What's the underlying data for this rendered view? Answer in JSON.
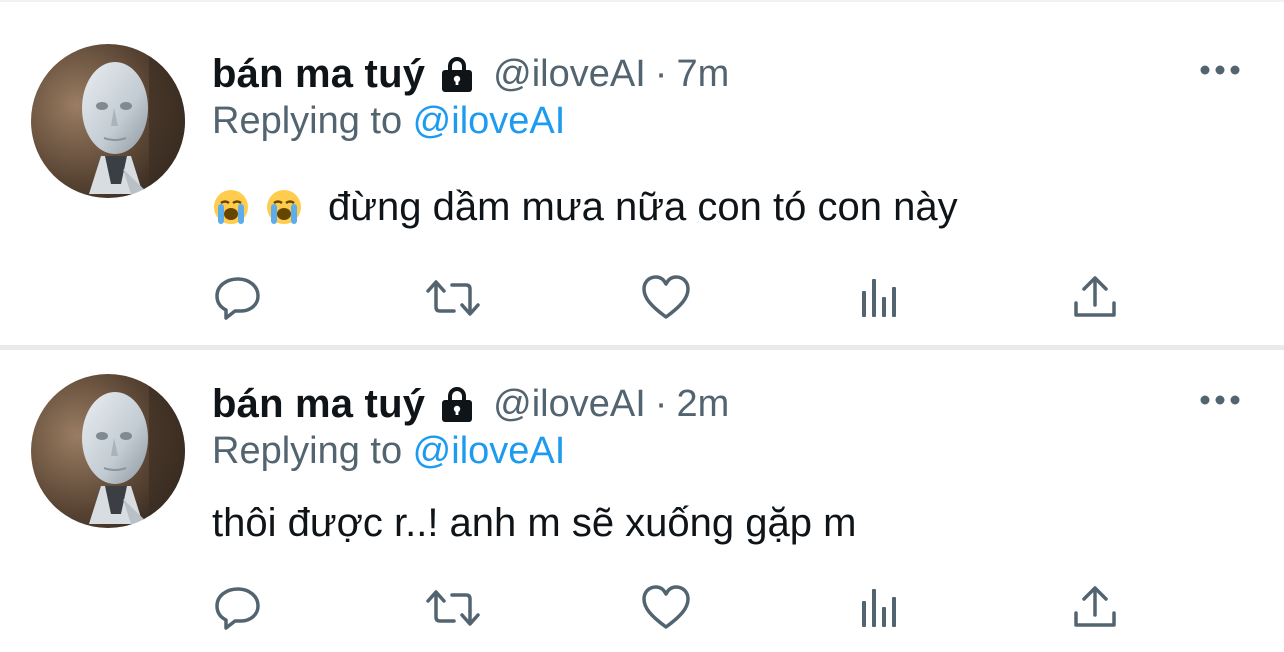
{
  "colors": {
    "text_primary": "#0f1419",
    "text_secondary": "#536471",
    "link": "#1d9bf0",
    "icon": "#536471",
    "divider": "#e8eaeb"
  },
  "tweets": [
    {
      "display_name": "bán ma tuý",
      "lock_icon": "lock-icon",
      "handle": "@iloveAI",
      "separator": "·",
      "time": "7m",
      "replying_prefix": "Replying to",
      "replying_handle": "@iloveAI",
      "emojis": [
        "😭",
        "😭"
      ],
      "text": "đừng dầm mưa nữa con tó con này",
      "actions": [
        "reply-icon",
        "retweet-icon",
        "like-icon",
        "views-icon",
        "share-icon"
      ]
    },
    {
      "display_name": "bán ma tuý",
      "lock_icon": "lock-icon",
      "handle": "@iloveAI",
      "separator": "·",
      "time": "2m",
      "replying_prefix": "Replying to",
      "replying_handle": "@iloveAI",
      "emojis": [],
      "text": "thôi được r..! anh m sẽ xuống gặp m",
      "actions": [
        "reply-icon",
        "retweet-icon",
        "like-icon",
        "views-icon",
        "share-icon"
      ]
    }
  ]
}
